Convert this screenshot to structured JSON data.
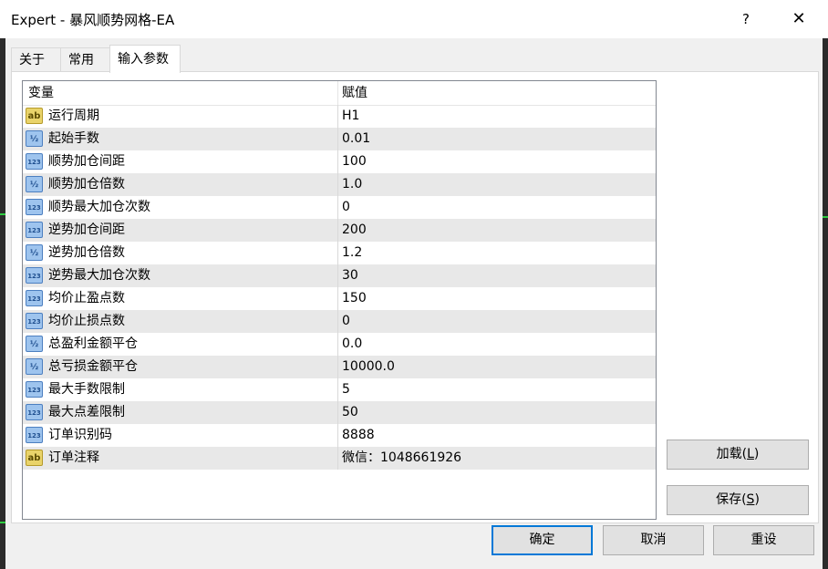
{
  "window": {
    "title": "Expert - 暴风顺势网格-EA",
    "help_label": "?",
    "close_label": "✕"
  },
  "tabs": [
    {
      "label": "关于"
    },
    {
      "label": "常用"
    },
    {
      "label": "输入参数"
    }
  ],
  "grid": {
    "headers": {
      "variable": "变量",
      "value": "赋值"
    },
    "rows": [
      {
        "type": "string",
        "icon": "ab",
        "name": "运行周期",
        "value": "H1"
      },
      {
        "type": "double",
        "icon": "½",
        "name": "起始手数",
        "value": "0.01"
      },
      {
        "type": "int",
        "icon": "123",
        "name": "顺势加仓间距",
        "value": "100"
      },
      {
        "type": "double",
        "icon": "½",
        "name": "顺势加仓倍数",
        "value": "1.0"
      },
      {
        "type": "int",
        "icon": "123",
        "name": "顺势最大加仓次数",
        "value": "0"
      },
      {
        "type": "int",
        "icon": "123",
        "name": "逆势加仓间距",
        "value": "200"
      },
      {
        "type": "double",
        "icon": "½",
        "name": "逆势加仓倍数",
        "value": "1.2"
      },
      {
        "type": "int",
        "icon": "123",
        "name": "逆势最大加仓次数",
        "value": "30"
      },
      {
        "type": "int",
        "icon": "123",
        "name": "均价止盈点数",
        "value": "150"
      },
      {
        "type": "int",
        "icon": "123",
        "name": "均价止损点数",
        "value": "0"
      },
      {
        "type": "double",
        "icon": "½",
        "name": "总盈利金额平仓",
        "value": "0.0"
      },
      {
        "type": "double",
        "icon": "½",
        "name": "总亏损金额平仓",
        "value": "10000.0"
      },
      {
        "type": "int",
        "icon": "123",
        "name": "最大手数限制",
        "value": "5"
      },
      {
        "type": "int",
        "icon": "123",
        "name": "最大点差限制",
        "value": "50"
      },
      {
        "type": "int",
        "icon": "123",
        "name": "订单识别码",
        "value": "8888"
      },
      {
        "type": "string",
        "icon": "ab",
        "name": "订单注释",
        "value": "微信：1048661926"
      }
    ]
  },
  "buttons": {
    "load": {
      "label": "加载(",
      "key": "L",
      "suffix": ")"
    },
    "save": {
      "label": "保存(",
      "key": "S",
      "suffix": ")"
    },
    "ok": "确定",
    "cancel": "取消",
    "reset": "重设"
  }
}
